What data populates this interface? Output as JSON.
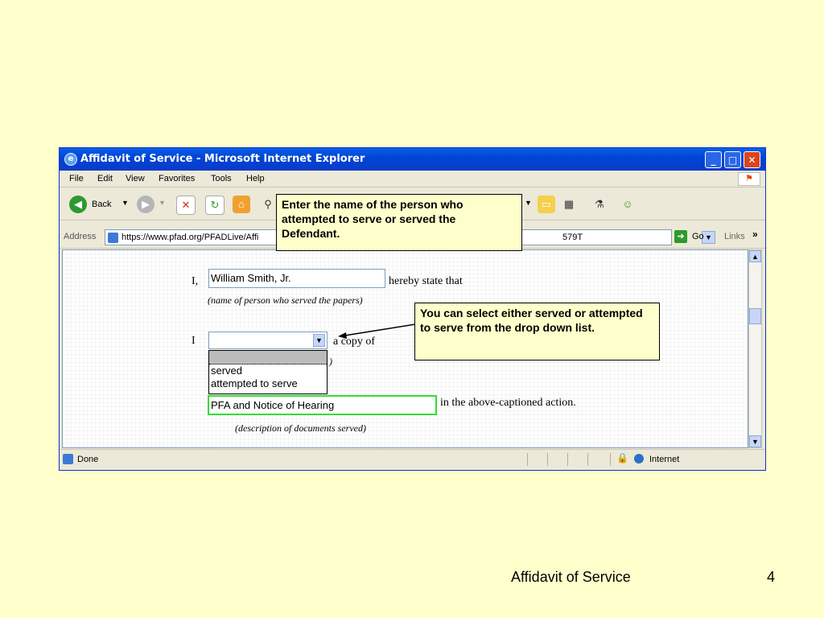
{
  "window": {
    "title": "Affidavit of Service - Microsoft Internet Explorer"
  },
  "menu": [
    "File",
    "Edit",
    "View",
    "Favorites",
    "Tools",
    "Help"
  ],
  "toolbar": {
    "back_label": "Back"
  },
  "address": {
    "label": "Address",
    "url": "https://www.pfad.org/PFADLive/Affi",
    "url_tail": "579T",
    "go_label": "Go",
    "links_label": "Links"
  },
  "form": {
    "line1_prefix": "I,",
    "name_value": "William Smith, Jr.",
    "line1_suffix": "hereby state that",
    "name_caption": "(name of person who served the papers)",
    "line2_prefix": "I",
    "line2_suffix": "a copy of",
    "dropdown_options": [
      "",
      "served",
      "attempted to serve"
    ],
    "partial_caption": ")",
    "docs_value": "PFA and Notice of Hearing",
    "docs_suffix": "in the above-captioned action.",
    "docs_caption": "(description of documents served)"
  },
  "status": {
    "text": "Done",
    "zone": "Internet"
  },
  "callouts": {
    "name": "Enter the name of the person who attempted to serve or served the Defendant.",
    "served": "You can select either served or attempted to serve from the drop down list."
  },
  "footer": {
    "title": "Affidavit of Service",
    "page": "4"
  }
}
